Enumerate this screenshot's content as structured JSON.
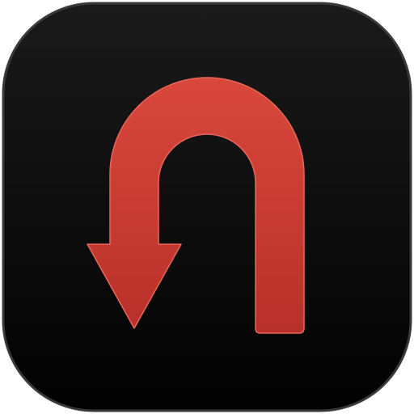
{
  "icon": {
    "name": "u-turn-arrow-icon",
    "colors": {
      "tile_top": "#1a1a1a",
      "tile_bottom": "#020202",
      "tile_edge": "#3a3a3a",
      "arrow_light": "#d8483c",
      "arrow_dark": "#b8302a",
      "arrow_highlight": "#e9665a"
    }
  }
}
